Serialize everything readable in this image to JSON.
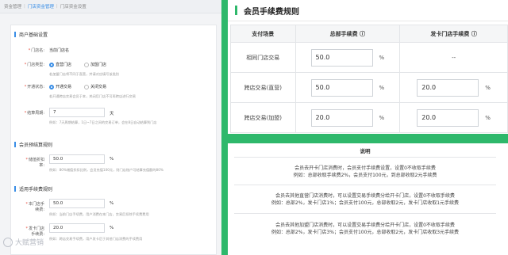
{
  "breadcrumb": {
    "items": [
      "资金管理",
      "门店资金管理",
      "门店资金设置"
    ]
  },
  "merchant_settings": {
    "title": "商户基础设置",
    "store_name_label": "门店名",
    "store_name_value": "当前门店名",
    "store_type_label": "门店类型",
    "store_type_options": [
      "直营门店",
      "加盟门店"
    ],
    "store_type_hint": "若加盟门店将不同于直营，并请对应填写该类别",
    "cross_store_label": "开通状态",
    "cross_store_options": [
      "开通交易",
      "关闭交易"
    ],
    "cross_store_hint": "若开通跨店交易会员于本，关闭后门店不可再跨店进行交易",
    "settle_days_label": "结算周期",
    "settle_days_value": "7",
    "settle_days_unit": "天",
    "settle_days_hint": "例如：7天周期结算，1日~7日之间的交易订单，会在8日自动结算到门店"
  },
  "prepaid_rules": {
    "title": "会员预结算规则",
    "ratio_label": "储值折扣率",
    "ratio_value": "50.0",
    "ratio_unit": "%",
    "ratio_hint": "例如：80%储值折扣比例，会员充值100元，则门店账户可结算充值额的80%"
  },
  "fee_rules": {
    "title": "适用手续费规则",
    "same_store_label": "本门店手续费",
    "same_store_value": "50.0",
    "same_store_unit": "%",
    "same_store_hint": "例如：当前门店手续费，用户消费在本门店，交易后扣除手续费费用",
    "card_store_label": "发卡门店手续费",
    "card_store_value": "20.0",
    "card_store_unit": "%",
    "card_store_hint": "例如：跨店交易手续费，用户发卡后于其他门店消费的手续费用"
  },
  "watermark": "大赋营销",
  "fee_panel": {
    "title": "会员手续费规则",
    "columns": [
      "支付场景",
      "总部手续费 ⓘ",
      "发卡门店手续费 ⓘ"
    ],
    "rows": [
      {
        "scene": "相同门店交易",
        "hq": "50.0",
        "card": "--"
      },
      {
        "scene": "跨店交易(直营)",
        "hq": "50.0",
        "card": "20.0"
      },
      {
        "scene": "跨店交易(加盟)",
        "hq": "20.0",
        "card": "20.0"
      }
    ],
    "unit": "%"
  },
  "explain": {
    "title": "说明",
    "blocks": [
      [
        "会员去开卡门店消费时，会员支付手续费设置，设置0不收取手续费",
        "例如：总部收取手续费2%，会员支付100元，到总部收取2元手续费"
      ],
      [
        "会员去其他直营门店消费时，可以设置交易手续费分给开卡门店，设置0不收取手续费",
        "例如：总部2%，发卡门店1%；会员支付100元，总部收取2元，发卡门店收取1元手续费"
      ],
      [
        "会员去其他加盟门店消费时，可以设置交易手续费分给开卡门店，设置0不收取手续费",
        "例如：总部2%，发卡门店3%；会员支付100元，总部收取2元，发卡门店收取3元手续费"
      ]
    ]
  }
}
